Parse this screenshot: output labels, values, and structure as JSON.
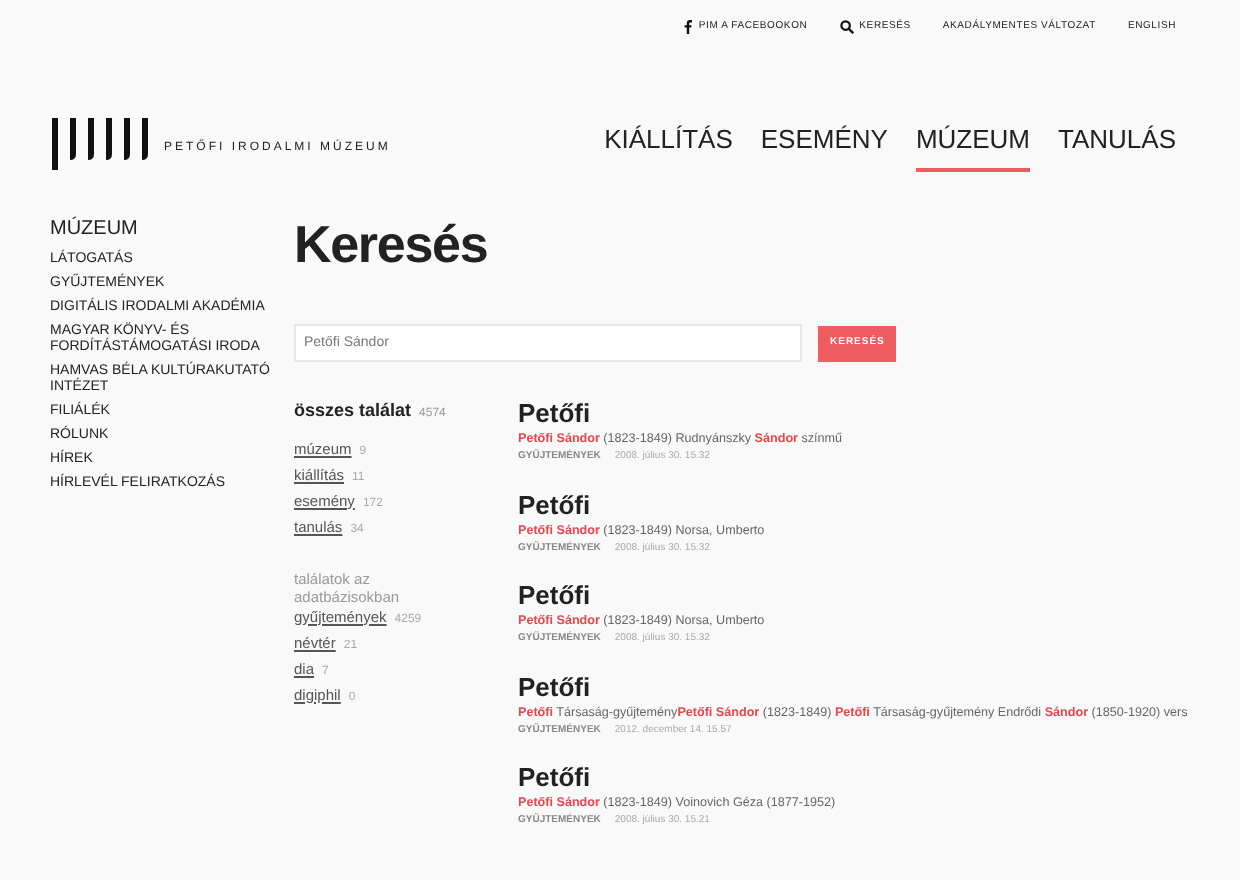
{
  "top_links": [
    {
      "kind": "facebook",
      "label": "PIM A FACEBOOKON"
    },
    {
      "kind": "search",
      "label": "KERESÉS"
    },
    {
      "kind": "plain",
      "label": "AKADÁLYMENTES VÁLTOZAT"
    },
    {
      "kind": "plain",
      "label": "ENGLISH"
    }
  ],
  "logo_text": "PETŐFI IRODALMI MÚZEUM",
  "main_nav": [
    {
      "label": "KIÁLLÍTÁS",
      "selected": false
    },
    {
      "label": "ESEMÉNY",
      "selected": false
    },
    {
      "label": "MÚZEUM",
      "selected": true
    },
    {
      "label": "TANULÁS",
      "selected": false
    }
  ],
  "sidebar": {
    "title": "MÚZEUM",
    "items": [
      "LÁTOGATÁS",
      "GYŰJTEMÉNYEK",
      "DIGITÁLIS IRODALMI AKADÉMIA",
      "MAGYAR KÖNYV- ÉS FORDÍTÁSTÁMOGATÁSI IRODA",
      "HAMVAS BÉLA KULTÚRAKUTATÓ INTÉZET",
      "FILIÁLÉK",
      "RÓLUNK",
      "HÍREK",
      "HÍRLEVÉL FELIRATKOZÁS"
    ]
  },
  "page_title": "Keresés",
  "search": {
    "value": "Petőfi Sándor",
    "button": "KERESÉS"
  },
  "filters": {
    "total_label": "összes találat",
    "total_count": "4574",
    "sections": [
      {
        "label": "múzeum",
        "count": "9"
      },
      {
        "label": "kiállítás",
        "count": "11"
      },
      {
        "label": "esemény",
        "count": "172"
      },
      {
        "label": "tanulás",
        "count": "34"
      }
    ],
    "db_heading": "találatok az adatbázisokban",
    "databases": [
      {
        "label": "gyűjtemények",
        "count": "4259"
      },
      {
        "label": "névtér",
        "count": "21"
      },
      {
        "label": "dia",
        "count": "7"
      },
      {
        "label": "digiphil",
        "count": "0"
      }
    ]
  },
  "results": [
    {
      "title": "Petőfi",
      "snippet": "**Petőfi Sándor** (1823-1849) Rudnyánszky **Sándor** színmű",
      "category": "GYŰJTEMÉNYEK",
      "date": "2008. július 30. 15.32"
    },
    {
      "title": "Petőfi",
      "snippet": "**Petőfi Sándor** (1823-1849) Norsa, Umberto",
      "category": "GYŰJTEMÉNYEK",
      "date": "2008. július 30. 15.32"
    },
    {
      "title": "Petőfi",
      "snippet": "**Petőfi Sándor** (1823-1849) Norsa, Umberto",
      "category": "GYŰJTEMÉNYEK",
      "date": "2008. július 30. 15.32"
    },
    {
      "title": "Petőfi",
      "snippet": "**Petőfi** Társaság-gyűjtemény**Petőfi Sándor** (1823-1849) **Petőfi** Társaság-gyűjtemény Endrődi **Sándor** (1850-1920) vers",
      "category": "GYŰJTEMÉNYEK",
      "date": "2012. december 14. 15.57"
    },
    {
      "title": "Petőfi",
      "snippet": "**Petőfi Sándor** (1823-1849) Voinovich Géza (1877-1952)",
      "category": "GYŰJTEMÉNYEK",
      "date": "2008. július 30. 15.21"
    }
  ]
}
